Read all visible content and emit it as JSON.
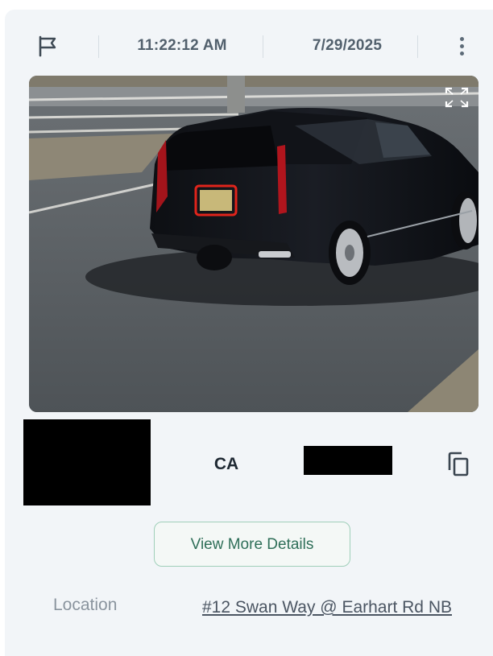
{
  "header": {
    "flag_icon": "flag-icon",
    "time": "11:22:12 AM",
    "date": "7/29/2025",
    "menu_icon": "more-vertical-icon"
  },
  "photo": {
    "description_icon": "vehicle-photo",
    "expand_icon": "fullscreen-expand-icon"
  },
  "plate": {
    "state": "CA",
    "copy_icon": "copy-icon"
  },
  "actions": {
    "view_details_label": "View More Details"
  },
  "location": {
    "label": "Location",
    "value": "#12 Swan Way @ Earhart Rd NB"
  },
  "colors": {
    "card_bg": "#f2f5f8",
    "accent_green": "#2f6f59",
    "highlight_box": "#e0241b"
  }
}
